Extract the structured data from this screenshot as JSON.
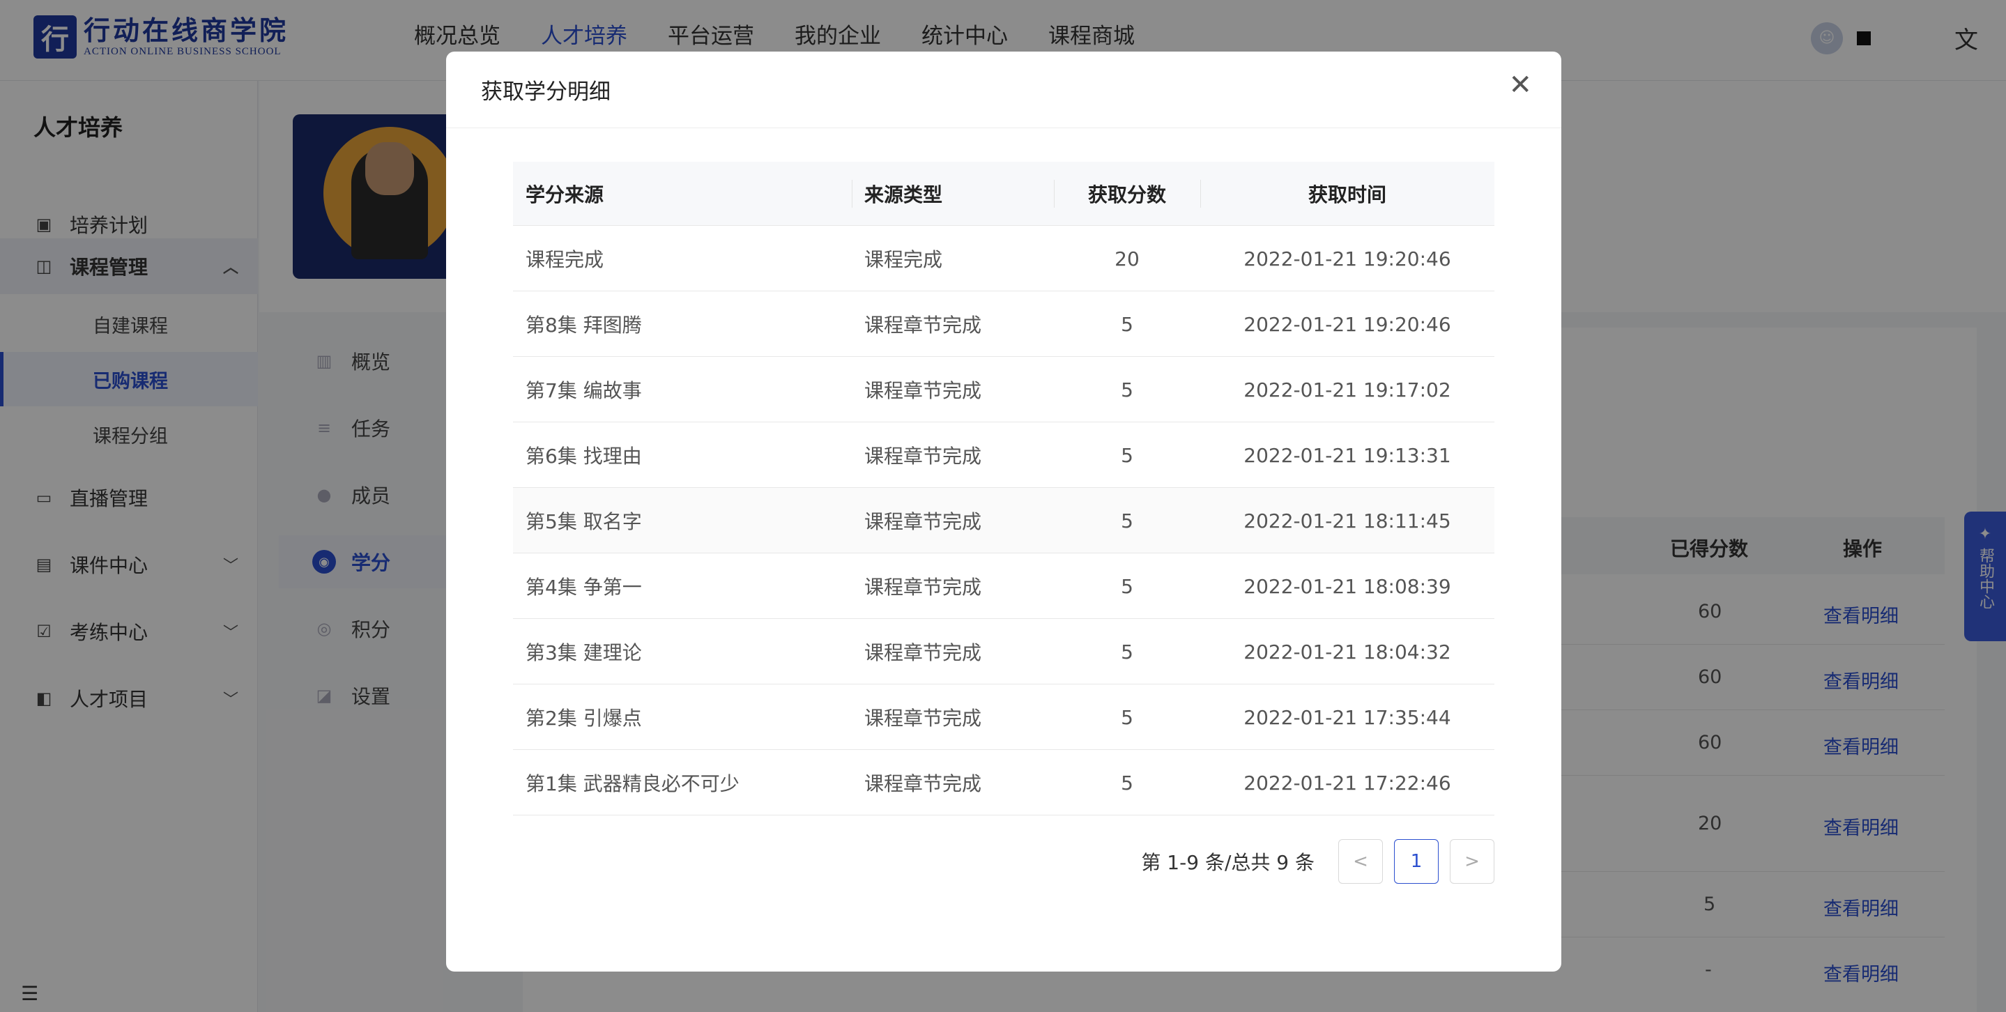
{
  "brand": {
    "cn": "行动在线商学院",
    "en": "ACTION ONLINE BUSINESS SCHOOL"
  },
  "nav": [
    "概况总览",
    "人才培养",
    "平台运营",
    "我的企业",
    "统计中心",
    "课程商城"
  ],
  "nav_active_index": 1,
  "sidebar": {
    "title": "人才培养",
    "items": [
      {
        "label": "培养计划",
        "icon": "calendar-icon"
      },
      {
        "label": "课程管理",
        "icon": "book-icon",
        "expanded": true
      },
      {
        "label": "直播管理",
        "icon": "video-icon"
      },
      {
        "label": "课件中心",
        "icon": "inbox-icon"
      },
      {
        "label": "考练中心",
        "icon": "exam-icon"
      },
      {
        "label": "人才项目",
        "icon": "project-icon"
      }
    ],
    "sub_items": [
      "自建课程",
      "已购课程",
      "课程分组"
    ],
    "sub_active_index": 1
  },
  "inner_nav": [
    {
      "label": "概览",
      "icon": "chart-icon"
    },
    {
      "label": "任务",
      "icon": "task-icon"
    },
    {
      "label": "成员",
      "icon": "member-icon"
    },
    {
      "label": "学分",
      "icon": "credit-icon"
    },
    {
      "label": "积分",
      "icon": "points-icon"
    },
    {
      "label": "设置",
      "icon": "settings-icon"
    }
  ],
  "inner_nav_active_index": 3,
  "background_table": {
    "headers": [
      "已得分数",
      "操作"
    ],
    "rows": [
      {
        "score": "60",
        "action": "查看明细"
      },
      {
        "score": "60",
        "action": "查看明细"
      },
      {
        "score": "60",
        "action": "查看明细"
      },
      {
        "score": "20",
        "action": "查看明细"
      },
      {
        "score": "5",
        "action": "查看明细"
      },
      {
        "score": "-",
        "action": "查看明细"
      }
    ]
  },
  "help_tab": "帮助中心",
  "modal": {
    "title": "获取学分明细",
    "columns": [
      "学分来源",
      "来源类型",
      "获取分数",
      "获取时间"
    ],
    "rows": [
      {
        "source": "课程完成",
        "type": "课程完成",
        "score": "20",
        "time": "2022-01-21 19:20:46"
      },
      {
        "source": "第8集 拜图腾",
        "type": "课程章节完成",
        "score": "5",
        "time": "2022-01-21 19:20:46"
      },
      {
        "source": "第7集 编故事",
        "type": "课程章节完成",
        "score": "5",
        "time": "2022-01-21 19:17:02"
      },
      {
        "source": "第6集 找理由",
        "type": "课程章节完成",
        "score": "5",
        "time": "2022-01-21 19:13:31"
      },
      {
        "source": "第5集 取名字",
        "type": "课程章节完成",
        "score": "5",
        "time": "2022-01-21 18:11:45"
      },
      {
        "source": "第4集 争第一",
        "type": "课程章节完成",
        "score": "5",
        "time": "2022-01-21 18:08:39"
      },
      {
        "source": "第3集 建理论",
        "type": "课程章节完成",
        "score": "5",
        "time": "2022-01-21 18:04:32"
      },
      {
        "source": "第2集 引爆点",
        "type": "课程章节完成",
        "score": "5",
        "time": "2022-01-21 17:35:44"
      },
      {
        "source": "第1集 武器精良必不可少",
        "type": "课程章节完成",
        "score": "5",
        "time": "2022-01-21 17:22:46"
      }
    ],
    "pagination": {
      "info": "第 1-9 条/总共 9 条",
      "current_page": "1",
      "prev": "<",
      "next": ">"
    }
  }
}
